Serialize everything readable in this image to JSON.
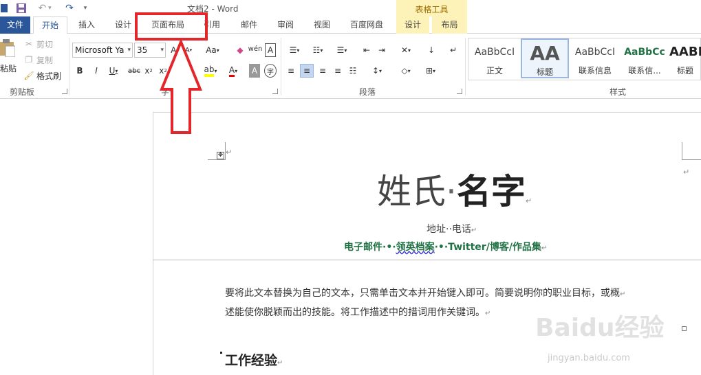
{
  "titlebar": {
    "doc_title": "文档2 - Word",
    "tool_context": "表格工具"
  },
  "tabs": {
    "file": "文件",
    "home": "开始",
    "insert": "插入",
    "design": "设计",
    "page_layout": "页面布局",
    "references": "引用",
    "mailings": "邮件",
    "review": "审阅",
    "view": "视图",
    "baidu_netdisk": "百度网盘",
    "table_design": "设计",
    "table_layout": "布局"
  },
  "clipboard": {
    "paste": "粘贴",
    "cut": "剪切",
    "copy": "复制",
    "format_painter": "格式刷",
    "group_label": "剪贴板"
  },
  "font": {
    "name": "Microsoft Ya",
    "size": "35",
    "group_label": "字体"
  },
  "paragraph": {
    "group_label": "段落"
  },
  "styles": {
    "group_label": "样式",
    "items": [
      {
        "preview": "AaBbCcI",
        "name": "正文"
      },
      {
        "preview": "AA",
        "name": "标题"
      },
      {
        "preview": "AaBbCcI",
        "name": "联系信息"
      },
      {
        "preview": "AaBbCc",
        "name": "联系信..."
      },
      {
        "preview": "AABI",
        "name": "标题"
      }
    ]
  },
  "document": {
    "name_light": "姓氏",
    "name_dot": "·",
    "name_bold": "名字",
    "contact": "地址··电话",
    "links_prefix": "电子邮件·•·",
    "links_wavy": "领英档案",
    "links_suffix": "·•·Twitter/博客/作品集",
    "body_line1": "要将此文本替换为自己的文本，只需单击文本并开始键入即可。简要说明你的职业目标，或概",
    "body_line2": "述能使你脱颖而出的技能。将工作描述中的措词用作关键词。",
    "work_heading": "工作经验"
  },
  "watermark": {
    "line1": "Baidu经验",
    "line2": "jingyan.baidu.com"
  },
  "colors": {
    "file_tab": "#2b579a",
    "highlight": "#e3262b",
    "link_green": "#217346",
    "tool_context": "#fdf3b8"
  }
}
